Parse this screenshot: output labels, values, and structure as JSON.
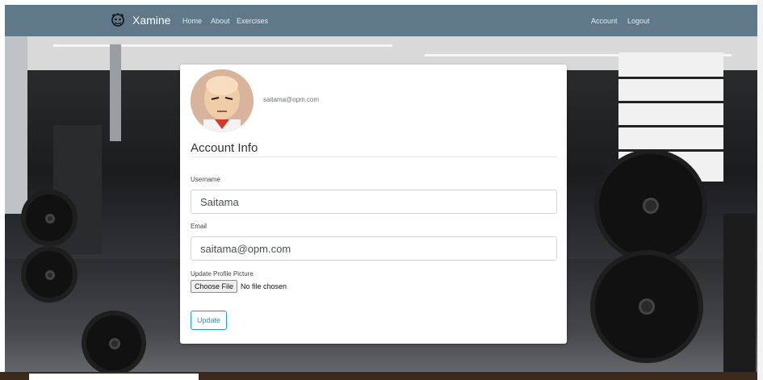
{
  "navbar": {
    "brand": "Xamine",
    "links": [
      "Home",
      "About",
      "Exercises"
    ],
    "right_links": [
      "Account",
      "Logout"
    ]
  },
  "profile": {
    "email_header": "saitama@opm.com",
    "section_title": "Account Info",
    "username_label": "Username",
    "username_value": "Saitama",
    "email_label": "Email",
    "email_value": "saitama@opm.com",
    "picture_label": "Update Profile Picture",
    "file_button": "Choose File",
    "file_status": "No file chosen",
    "update_button": "Update"
  },
  "colors": {
    "navbar": "#5f788a",
    "accent": "#17a2b8"
  },
  "icons": [
    "xamine-logo-icon",
    "avatar"
  ]
}
